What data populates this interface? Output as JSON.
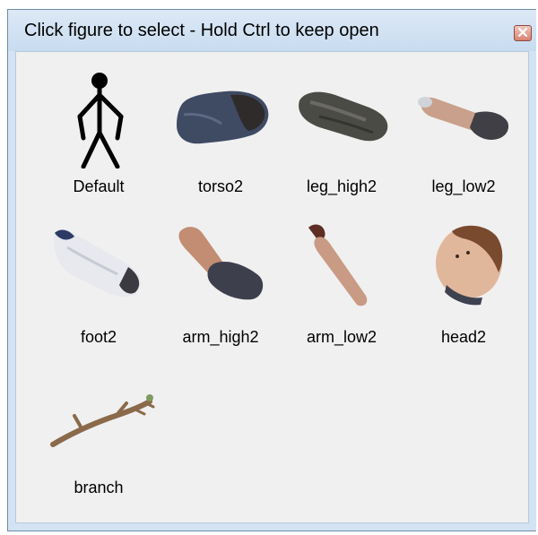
{
  "window": {
    "title": "Click figure to select - Hold Ctrl to keep open"
  },
  "figures": [
    {
      "label": "Default",
      "icon": "stick-figure-icon"
    },
    {
      "label": "torso2",
      "icon": "torso-photo-icon"
    },
    {
      "label": "leg_high2",
      "icon": "leg-high-photo-icon"
    },
    {
      "label": "leg_low2",
      "icon": "leg-low-photo-icon"
    },
    {
      "label": "foot2",
      "icon": "foot-photo-icon"
    },
    {
      "label": "arm_high2",
      "icon": "arm-high-photo-icon"
    },
    {
      "label": "arm_low2",
      "icon": "arm-low-photo-icon"
    },
    {
      "label": "head2",
      "icon": "head-photo-icon"
    },
    {
      "label": "branch",
      "icon": "branch-photo-icon"
    }
  ],
  "colors": {
    "titlebar": "#c8dcf0",
    "content_bg": "#f0f0f0",
    "close_button": "#d9826f"
  }
}
